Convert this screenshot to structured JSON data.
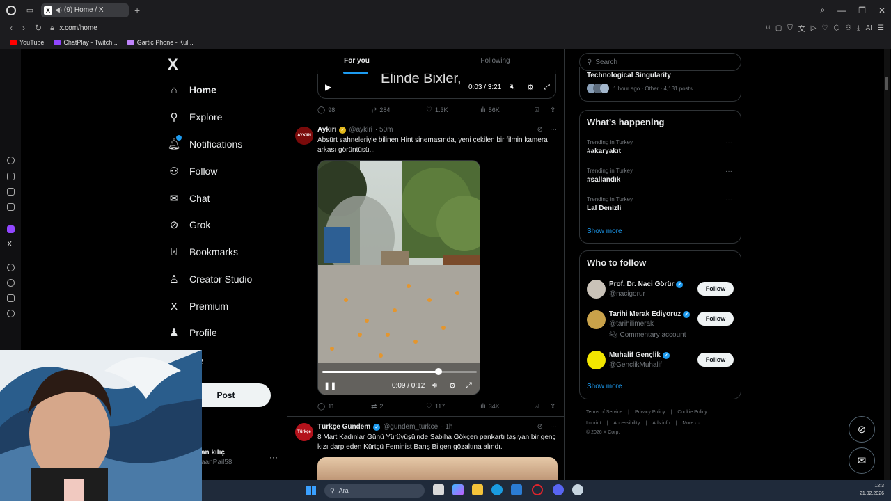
{
  "browser": {
    "tab_title": "(9) Home / X",
    "url": "x.com/home",
    "bookmarks": [
      {
        "label": "YouTube",
        "color": "#ff0000"
      },
      {
        "label": "ChatPlay - Twitch...",
        "color": "#9146ff"
      },
      {
        "label": "Gartic Phone - Kul...",
        "color": "#c084fc"
      }
    ],
    "ext_ai_label": "AI"
  },
  "nav": {
    "logo": "X",
    "items": [
      {
        "label": "Home",
        "icon": "home-icon"
      },
      {
        "label": "Explore",
        "icon": "search-icon"
      },
      {
        "label": "Notifications",
        "icon": "bell-icon"
      },
      {
        "label": "Follow",
        "icon": "person-add-icon"
      },
      {
        "label": "Chat",
        "icon": "envelope-icon"
      },
      {
        "label": "Grok",
        "icon": "grok-icon"
      },
      {
        "label": "Bookmarks",
        "icon": "bookmark-icon"
      },
      {
        "label": "Creator Studio",
        "icon": "creator-icon"
      },
      {
        "label": "Premium",
        "icon": "x-premium-icon"
      },
      {
        "label": "Profile",
        "icon": "profile-icon"
      },
      {
        "label": "ore",
        "icon": "more-icon"
      }
    ],
    "post_label": "Post",
    "account_name": "an kılıç",
    "account_handle": "aanPail58"
  },
  "feed": {
    "tabs": [
      "For you",
      "Following"
    ],
    "prev_tweet": {
      "video_caption": "Elinde Bixler,",
      "video_time": "0:03 / 3:21",
      "replies": "98",
      "reposts": "284",
      "likes": "1.3K",
      "views": "56K"
    },
    "tweet1": {
      "avatar_text": "AYKIRI",
      "name": "Aykırı",
      "handle": "@aykiri",
      "time": "· 50m",
      "text": "Absürt sahneleriyle bilinen Hint sinemasında, yeni çekilen bir filmin kamera arkası görüntüsü...",
      "video_time": "0:09 / 0:12",
      "progress": 0.75,
      "replies": "11",
      "reposts": "2",
      "likes": "117",
      "views": "34K"
    },
    "tweet2": {
      "avatar_text": "Türkçe",
      "name": "Türkçe Gündem",
      "handle": "@gundem_turkce",
      "time": "· 1h",
      "text": "8 Mart Kadınlar Günü Yürüyüşü'nde Sabiha Gökçen pankartı taşıyan bir genç kızı darp eden Kürtçü Feminist Barış Bilgen gözaltına alındı."
    }
  },
  "right": {
    "search_placeholder": "Search",
    "top_trend": {
      "name": "Technological Singularity",
      "meta": "1 hour ago · Other · 4,131 posts"
    },
    "happening_title": "What’s happening",
    "trends": [
      {
        "category": "Trending in Turkey",
        "name": "#akaryakıt"
      },
      {
        "category": "Trending in Turkey",
        "name": "#sallandık"
      },
      {
        "category": "Trending in Turkey",
        "name": "Lal Denizli"
      }
    ],
    "show_more": "Show more",
    "who_title": "Who to follow",
    "who": [
      {
        "name": "Prof. Dr. Naci Görür",
        "handle": "@nacigorur",
        "sub": "",
        "avatar_color": "#c9c2b8"
      },
      {
        "name": "Tarihi Merak Ediyoruz",
        "handle": "@tarihilimerak",
        "sub": "Commentary account",
        "avatar_color": "#c9a24a"
      },
      {
        "name": "Muhalif Gençlik",
        "handle": "@GenclikMuhalif",
        "sub": "",
        "avatar_color": "#f2e600"
      }
    ],
    "follow_label": "Follow",
    "footer": [
      "Terms of Service",
      "|",
      "Privacy Policy",
      "|",
      "Cookie Policy",
      "|"
    ],
    "footer2": [
      "Imprint",
      "|",
      "Accessibility",
      "|",
      "Ads info",
      "|",
      "More ···"
    ],
    "copyright": "© 2026 X Corp."
  },
  "taskbar": {
    "search_placeholder": "Ara",
    "time": "12:3",
    "date": "21.02.2026"
  }
}
